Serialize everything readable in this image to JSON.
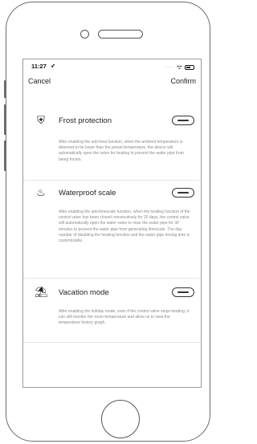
{
  "status_bar": {
    "time": "11:27",
    "location_glyph": "➶",
    "signal": "·····",
    "wifi_glyph": "ᯤ"
  },
  "nav": {
    "cancel": "Cancel",
    "confirm": "Confirm"
  },
  "settings": [
    {
      "icon": "shield-icon",
      "icon_glyph": "⛨",
      "title": "Frost protection",
      "enabled": false,
      "description": "After enabling the anti-frost function, when the ambient temperature is detected to be lower than the preset temperature, the device will automatically open the valve for heating to prevent the water pipe from being frozen."
    },
    {
      "icon": "water-scale-icon",
      "icon_glyph": "♨",
      "title": "Waterproof scale",
      "enabled": false,
      "description": "After enabling the anti-limescale function, when the heating function of the control valve has been closed consecutively for 20 days, the control valve will automatically open the water valve to rinse the water pipe for 30 minutes to prevent the water pipe from generating limescale. The day number of disabling the heating function and the water pipe rinsing time is customizable."
    },
    {
      "icon": "vacation-icon",
      "icon_glyph": "⛱",
      "title": "Vacation mode",
      "enabled": false,
      "description": "After enabling the holiday mode, even if the control valve stops heating, it can still monitor the room temperature and allow us to view the temperature history graph."
    }
  ]
}
